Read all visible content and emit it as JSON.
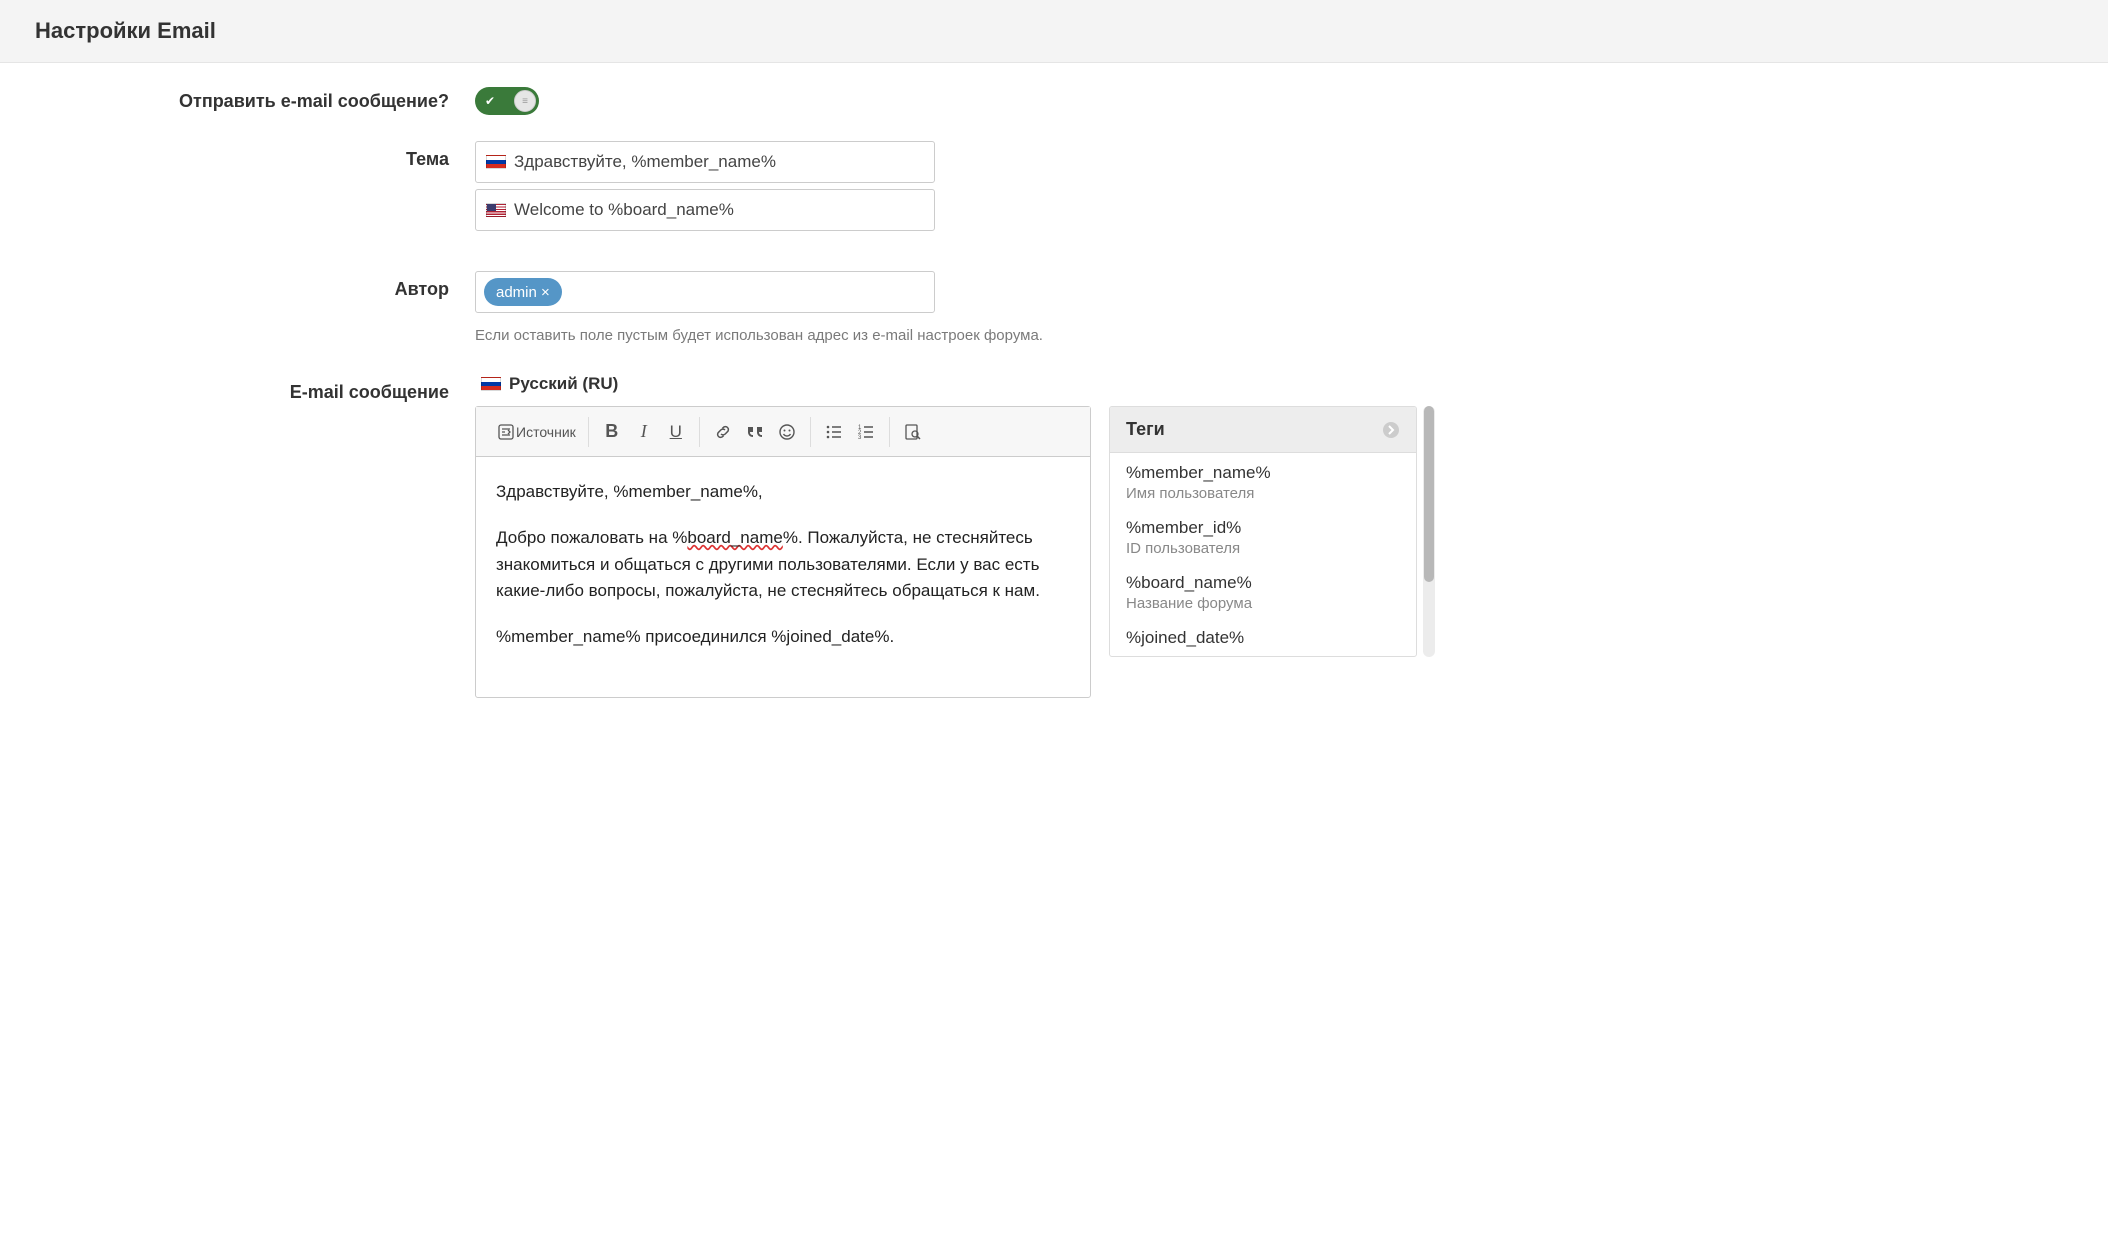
{
  "header": {
    "title": "Настройки Email"
  },
  "form": {
    "send_email_label": "Отправить e-mail сообщение?",
    "subject_label": "Тема",
    "subject_ru": "Здравствуйте, %member_name%",
    "subject_en": "Welcome to %board_name%",
    "author_label": "Автор",
    "author_chip": "admin ×",
    "author_hint": "Если оставить поле пустым будет использован адрес из e-mail настроек форума.",
    "message_label": "E-mail сообщение",
    "lang_ru": "Русский (RU)"
  },
  "toolbar": {
    "source": "Источник"
  },
  "editor": {
    "p1": "Здравствуйте, %member_name%,",
    "p2a": "Добро пожаловать на %",
    "p2b": "board_name",
    "p2c": "%. Пожалуйста, не стесняйтесь знакомиться и общаться с другими пользователями. Если у вас есть какие-либо вопросы, пожалуйста, не стесняйтесь обращаться к нам.",
    "p3": "%member_name% присоединился %joined_date%."
  },
  "tags": {
    "title": "Теги",
    "items": [
      {
        "tag": "%member_name%",
        "desc": "Имя пользователя"
      },
      {
        "tag": "%member_id%",
        "desc": "ID пользователя"
      },
      {
        "tag": "%board_name%",
        "desc": "Название форума"
      },
      {
        "tag": "%joined_date%",
        "desc": ""
      }
    ]
  }
}
